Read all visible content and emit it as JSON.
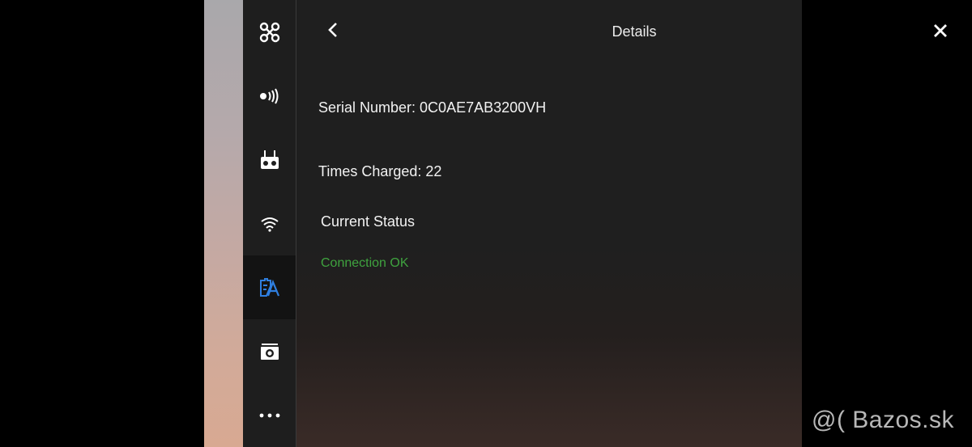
{
  "header": {
    "title": "Details"
  },
  "sidebar": {
    "items": [
      {
        "icon": "aircraft-icon",
        "active": false
      },
      {
        "icon": "signal-icon",
        "active": false
      },
      {
        "icon": "remote-controller-icon",
        "active": false
      },
      {
        "icon": "wifi-icon",
        "active": false
      },
      {
        "icon": "battery-icon",
        "active": true
      },
      {
        "icon": "camera-icon",
        "active": false
      },
      {
        "icon": "more-icon",
        "active": false
      }
    ]
  },
  "details": {
    "serial_number": "Serial Number: 0C0AE7AB3200VH",
    "times_charged": "Times Charged: 22",
    "status_heading": "Current Status",
    "status_value": "Connection OK"
  },
  "watermark": "@( Bazos.sk",
  "colors": {
    "accent": "#2f7fe0",
    "status_ok": "#3fa33f",
    "panel_bg": "#1f1f1f",
    "sidebar_bg": "#1e1e1e"
  }
}
